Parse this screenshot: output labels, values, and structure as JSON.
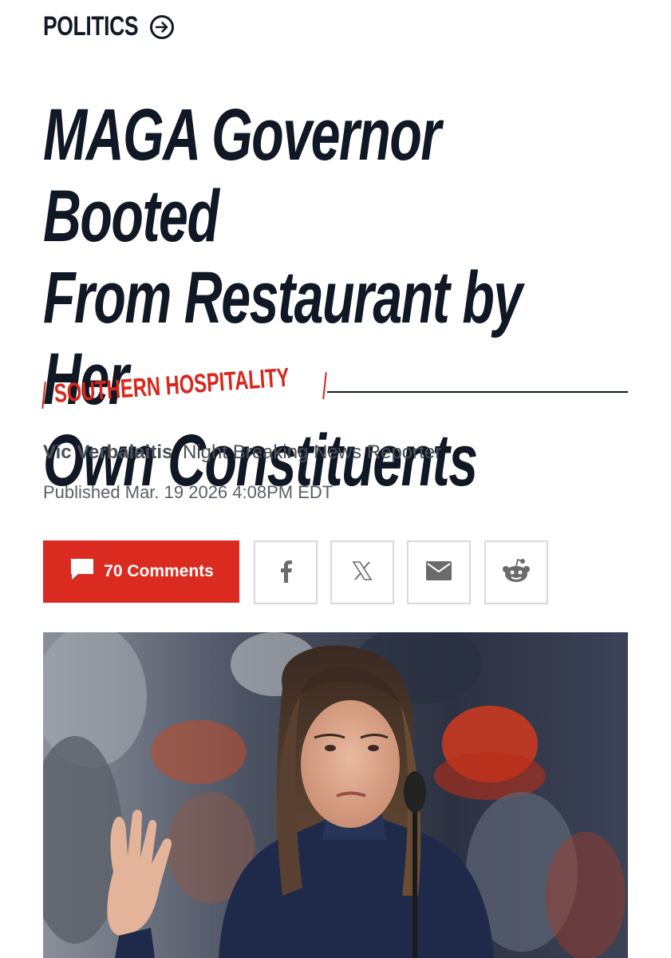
{
  "section": {
    "label": "POLITICS",
    "icon": "arrow-right-circle-icon"
  },
  "headline": {
    "line1": "MAGA Governor Booted",
    "line2": "From Restaurant by Her",
    "line3": "Own Constituents"
  },
  "rubric": {
    "label": "SOUTHERN HOSPITALITY",
    "color": "#d8261b"
  },
  "byline": {
    "author": "Vic Verbalaitis",
    "role": "Night Breaking News Reporter"
  },
  "published": "Published Mar. 19 2026 4:08PM EDT",
  "share": {
    "comments_label": "70 Comments",
    "comments_color": "#db2a20",
    "buttons": [
      {
        "name": "facebook",
        "icon": "facebook-icon"
      },
      {
        "name": "x",
        "icon": "x-icon"
      },
      {
        "name": "email",
        "icon": "email-icon"
      },
      {
        "name": "reddit",
        "icon": "reddit-icon"
      }
    ]
  },
  "photo": {
    "subject": "woman-at-microphone-raising-hand"
  }
}
